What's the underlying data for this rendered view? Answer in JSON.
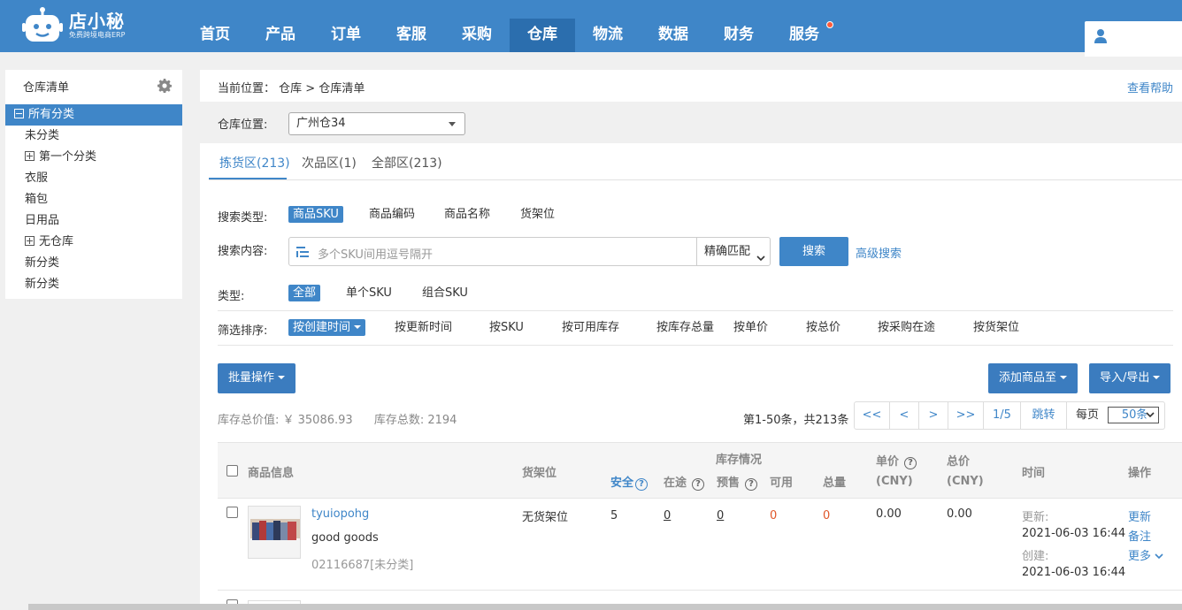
{
  "app": {
    "logo_text": "店小秘",
    "logo_sub": "免费跨境电商ERP"
  },
  "nav": {
    "items": [
      "首页",
      "产品",
      "订单",
      "客服",
      "采购",
      "仓库",
      "物流",
      "数据",
      "财务",
      "服务"
    ],
    "active": "仓库"
  },
  "sidebar": {
    "title": "仓库清单",
    "items": [
      "所有分类",
      "未分类",
      "第一个分类",
      "衣服",
      "箱包",
      "日用品",
      "无仓库",
      "新分类",
      "新分类"
    ]
  },
  "breadcrumb": {
    "prefix": "当前位置：",
    "path": "仓库 > 仓库清单",
    "help": "查看帮助"
  },
  "warehouse": {
    "label": "仓库位置:",
    "selected": "广州仓34"
  },
  "tabs": [
    "拣货区(213)",
    "次品区(1)",
    "全部区(213)"
  ],
  "search": {
    "type_label": "搜索类型:",
    "types": [
      "商品SKU",
      "商品编码",
      "商品名称",
      "货架位"
    ],
    "content_label": "搜索内容:",
    "placeholder": "多个SKU间用逗号隔开",
    "match": "精确匹配",
    "button": "搜索",
    "advanced": "高级搜索"
  },
  "filter": {
    "type_label": "类型:",
    "types": [
      "全部",
      "单个SKU",
      "组合SKU"
    ],
    "sort_label": "筛选排序:",
    "sorts": [
      "按创建时间",
      "按更新时间",
      "按SKU",
      "按可用库存",
      "按库存总量",
      "按单价",
      "按总价",
      "按采购在途",
      "按货架位"
    ]
  },
  "actions": {
    "batch": "批量操作",
    "add_to": "添加商品至",
    "import_export": "导入/导出"
  },
  "stats": {
    "total_value": "库存总价值: ￥ 35086.93",
    "total_count": "库存总数: 2194"
  },
  "pagination": {
    "info": "第1-50条，共213条",
    "first": "<<",
    "prev": "<",
    "next": ">",
    "last": ">>",
    "page": "1/5",
    "jump": "跳转",
    "per_page_label": "每页",
    "per_page": "50条"
  },
  "table": {
    "headers": {
      "product": "商品信息",
      "shelf": "货架位",
      "stock": "库存情况",
      "safe": "安全",
      "transit": "在途",
      "presale": "预售",
      "available": "可用",
      "total": "总量",
      "unit_price": "单价",
      "unit_price_unit": "(CNY)",
      "total_price": "总价",
      "total_price_unit": "(CNY)",
      "time": "时间",
      "ops": "操作"
    },
    "rows": [
      {
        "name": "tyuiopohg",
        "desc": "good goods",
        "code": "02116687[未分类]",
        "shelf": "无货架位",
        "safe": "5",
        "transit": "0",
        "presale": "0",
        "available": "0",
        "total": "0",
        "unit_price": "0.00",
        "total_price": "0.00",
        "updated_label": "更新:",
        "updated": "2021-06-03 16:44",
        "created_label": "创建:",
        "created": "2021-06-03 16:44",
        "op_update": "更新",
        "op_note": "备注",
        "op_more": "更多"
      }
    ]
  },
  "colors": {
    "primary": "#3f86c8",
    "nav_active": "#2b6eae",
    "alert": "#e0582b"
  }
}
